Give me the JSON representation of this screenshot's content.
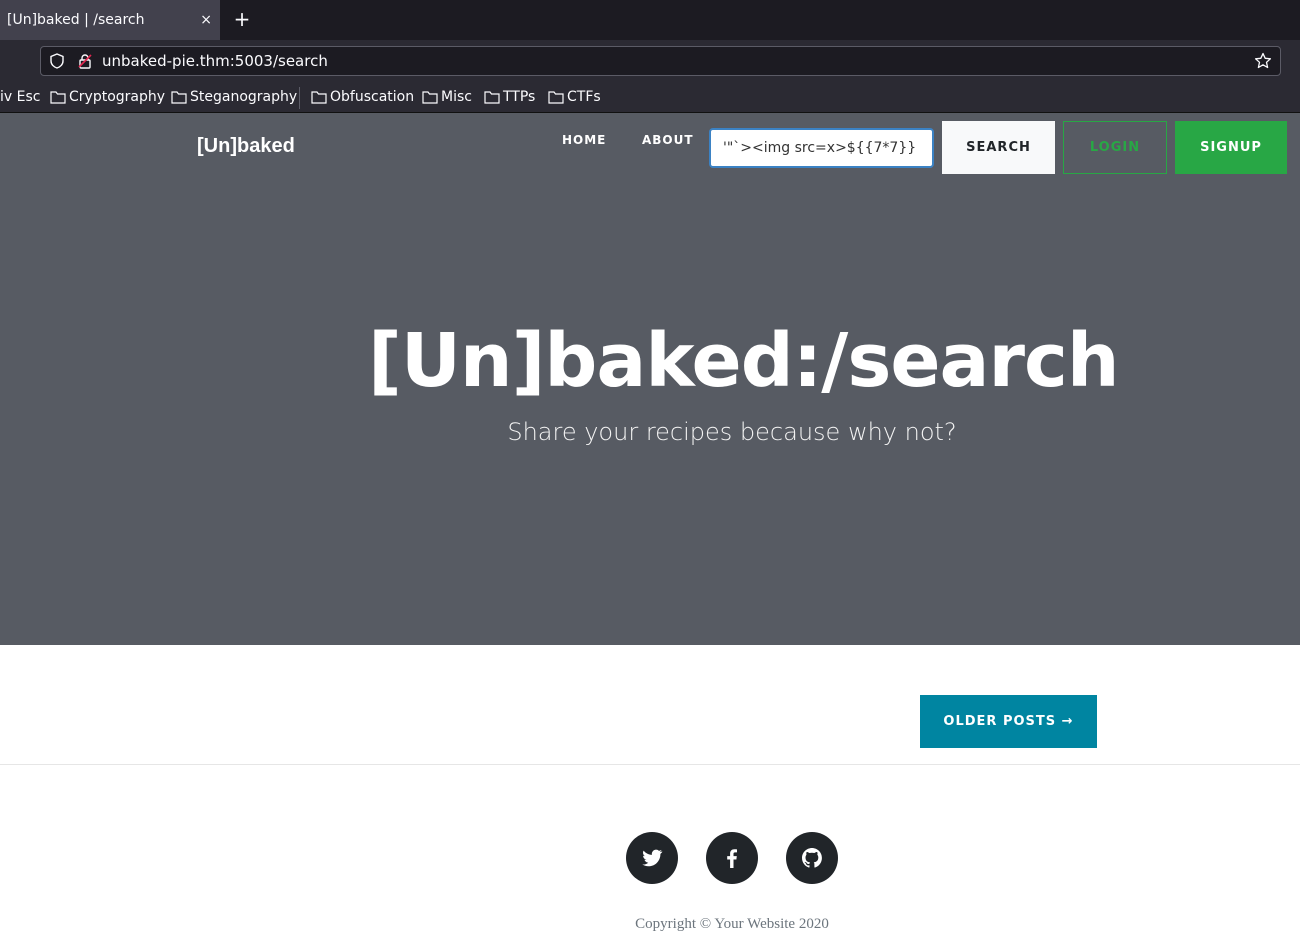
{
  "browser": {
    "tab_title": "[Un]baked | /search",
    "tab_close": "×",
    "new_tab": "+",
    "url": "unbaked-pie.thm:5003/search",
    "bookmarks": [
      "iv Esc",
      "Cryptography",
      "Steganography",
      "Obfuscation",
      "Misc",
      "TTPs",
      "CTFs"
    ]
  },
  "site": {
    "brand": "[Un]baked",
    "nav": {
      "home": "HOME",
      "about": "ABOUT"
    },
    "search_value": "'\"`><img src=x>${{7*7}}",
    "buttons": {
      "search": "SEARCH",
      "login": "LOGIN",
      "signup": "SIGNUP"
    },
    "hero_title": "[Un]baked:/search",
    "hero_subtitle": "Share your recipes because why not?",
    "older_posts": "OLDER POSTS →",
    "copyright": "Copyright © Your Website 2020"
  },
  "icons": [
    "shield-icon",
    "lock-icon",
    "star-icon",
    "folder-icon",
    "twitter-icon",
    "facebook-icon",
    "github-icon"
  ],
  "colors": {
    "hero_bg": "#575b63",
    "login": "#28a745",
    "older_posts": "#0085a1",
    "social_bg": "#212529"
  }
}
